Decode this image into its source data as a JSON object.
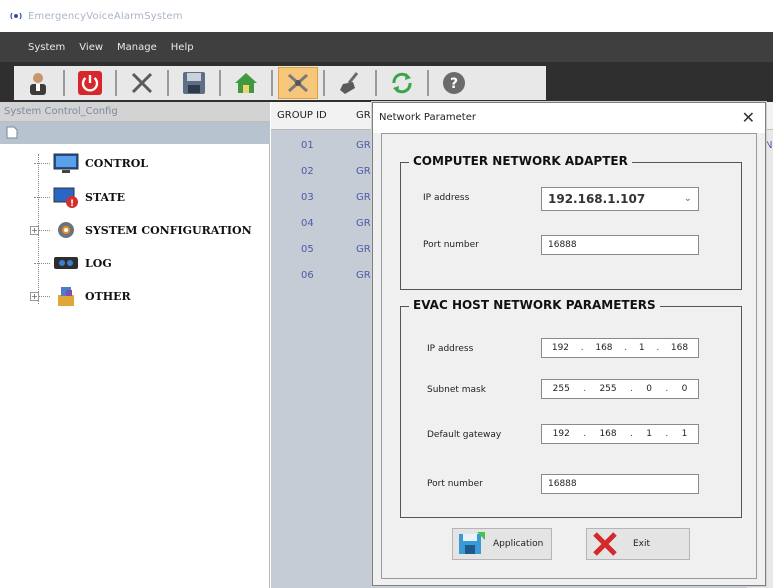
{
  "window": {
    "title": "EmergencyVoiceAlarmSystem"
  },
  "menu": {
    "items": [
      "System",
      "View",
      "Manage",
      "Help"
    ]
  },
  "toolbar": {
    "buttons": [
      "user-icon",
      "power-icon",
      "tools-icon",
      "save-icon",
      "home-icon",
      "network-icon",
      "broom-icon",
      "refresh-icon",
      "help-icon"
    ],
    "active": "network-icon"
  },
  "left_panel": {
    "header": "System Control_Config",
    "tree": [
      {
        "label": "CONTROL",
        "icon": "monitor-icon"
      },
      {
        "label": "STATE",
        "icon": "state-icon"
      },
      {
        "label": "SYSTEM CONFIGURATION",
        "icon": "gear-icon"
      },
      {
        "label": "LOG",
        "icon": "log-icon"
      },
      {
        "label": "OTHER",
        "icon": "other-icon"
      }
    ]
  },
  "group_table": {
    "headers": [
      "GROUP ID",
      "GR("
    ],
    "rows": [
      {
        "id": "01",
        "name": "GR("
      },
      {
        "id": "02",
        "name": "GR("
      },
      {
        "id": "03",
        "name": "GR("
      },
      {
        "id": "04",
        "name": "GR("
      },
      {
        "id": "05",
        "name": "GR("
      },
      {
        "id": "06",
        "name": "GR("
      }
    ],
    "right_edge": "N"
  },
  "dialog": {
    "title": "Network Parameter",
    "close": "✕",
    "computer_group": {
      "title": "COMPUTER NETWORK ADAPTER",
      "ip_label": "IP address",
      "ip_value": "192.168.1.107",
      "port_label": "Port number",
      "port_value": "16888"
    },
    "evac_group": {
      "title": "EVAC HOST NETWORK PARAMETERS",
      "ip_label": "IP address",
      "ip": [
        "192",
        "168",
        "1",
        "168"
      ],
      "subnet_label": "Subnet mask",
      "subnet": [
        "255",
        "255",
        "0",
        "0"
      ],
      "gateway_label": "Default gateway",
      "gateway": [
        "192",
        "168",
        "1",
        "1"
      ],
      "port_label": "Port number",
      "port_value": "16888"
    },
    "apply_label": "Application",
    "exit_label": "Exit"
  }
}
